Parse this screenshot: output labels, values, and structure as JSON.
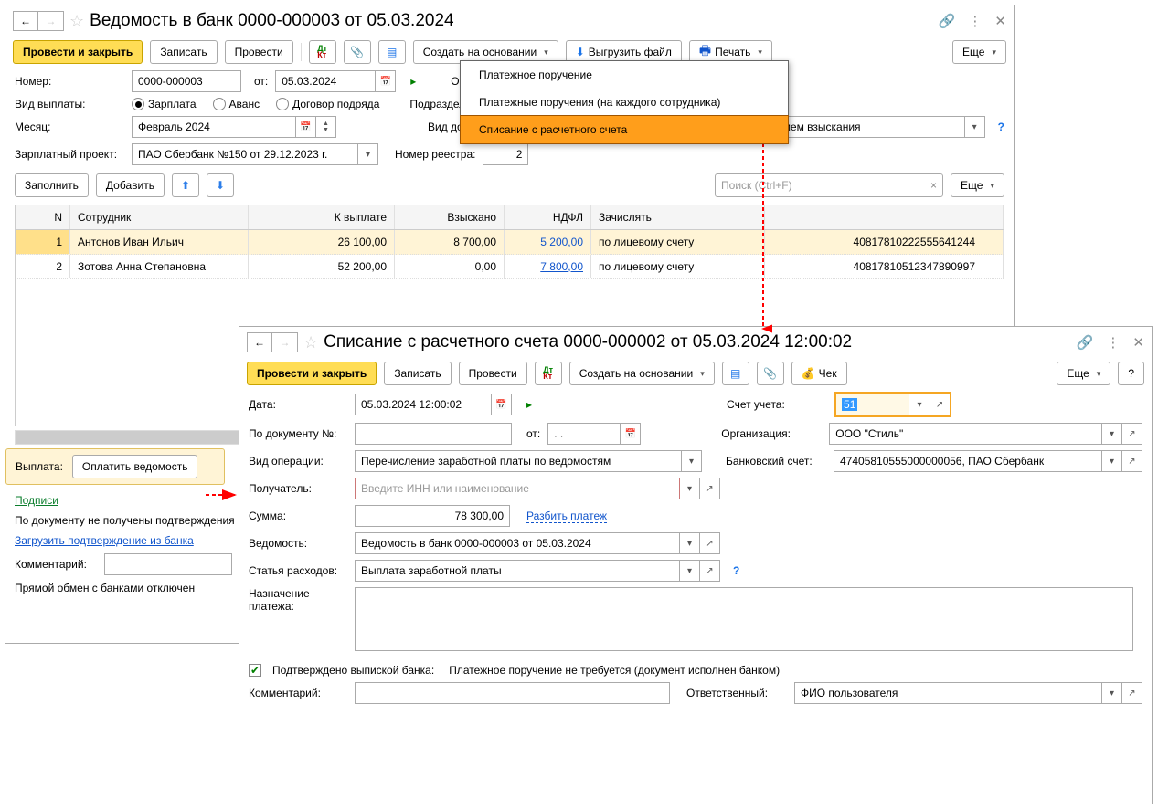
{
  "win1": {
    "title": "Ведомость в банк 0000-000003 от 05.03.2024",
    "toolbar": {
      "post_close": "Провести и закрыть",
      "save": "Записать",
      "post": "Провести",
      "create_based": "Создать на основании",
      "export_file": "Выгрузить файл",
      "print": "Печать",
      "more": "Еще"
    },
    "ctx_menu": {
      "item1": "Платежное поручение",
      "item2": "Платежные поручения (на каждого сотрудника)",
      "item3": "Списание с расчетного счета"
    },
    "labels": {
      "number": "Номер:",
      "date_from": "от:",
      "org": "Организация:",
      "pay_type": "Вид выплаты:",
      "subdiv": "Подразделение:",
      "month": "Месяц:",
      "income_type": "Вид дохода:",
      "salary_project": "Зарплатный проект:",
      "registry_num": "Номер реестра:",
      "fill": "Заполнить",
      "add": "Добавить",
      "search_ph": "Поиск (Ctrl+F)",
      "more2": "Еще",
      "payment": "Выплата:",
      "pay_btn": "Оплатить ведомость",
      "signatures": "Подписи",
      "no_confirm": "По документу не получены подтверждения",
      "load_confirm": "Загрузить подтверждение из банка",
      "comment": "Комментарий:",
      "exchange_off": "Прямой обмен с банками отключен"
    },
    "values": {
      "number": "0000-000003",
      "date": "05.03.2024",
      "month": "Февраль 2024",
      "income_type": "1 - Заработная плата и иные доходы с ограничением взыскания",
      "salary_project": "ПАО Сбербанк №150 от 29.12.2023 г.",
      "registry_num": "2"
    },
    "radios": {
      "salary": "Зарплата",
      "advance": "Аванс",
      "contract": "Договор подряда"
    },
    "table": {
      "headers": {
        "n": "N",
        "emp": "Сотрудник",
        "pay": "К выплате",
        "ded": "Взыскано",
        "tax": "НДФЛ",
        "acc": "Зачислять",
        "num": ""
      },
      "rows": [
        {
          "n": "1",
          "emp": "Антонов Иван Ильич",
          "pay": "26 100,00",
          "ded": "8 700,00",
          "tax": "5 200,00",
          "acc": "по лицевому счету",
          "num": "40817810222555641244"
        },
        {
          "n": "2",
          "emp": "Зотова Анна Степановна",
          "pay": "52 200,00",
          "ded": "0,00",
          "tax": "7 800,00",
          "acc": "по лицевому счету",
          "num": "40817810512347890997"
        }
      ]
    }
  },
  "win2": {
    "title": "Списание с расчетного счета 0000-000002 от 05.03.2024 12:00:02",
    "toolbar": {
      "post_close": "Провести и закрыть",
      "save": "Записать",
      "post": "Провести",
      "create_based": "Создать на основании",
      "check": "Чек",
      "more": "Еще",
      "help": "?"
    },
    "labels": {
      "date": "Дата:",
      "doc_no": "По документу №:",
      "from": "от:",
      "account": "Счет учета:",
      "org": "Организация:",
      "op_type": "Вид операции:",
      "bank_acc": "Банковский счет:",
      "recipient": "Получатель:",
      "recipient_ph": "Введите ИНН или наименование",
      "sum": "Сумма:",
      "split": "Разбить платеж",
      "vedom": "Ведомость:",
      "expense": "Статья расходов:",
      "purpose": "Назначение платежа:",
      "confirmed": "Подтверждено выпиской банка:",
      "confirm_text": "Платежное поручение не требуется (документ исполнен банком)",
      "comment": "Комментарий:",
      "responsible": "Ответственный:"
    },
    "values": {
      "date": "05.03.2024 12:00:02",
      "doc_no": "",
      "from": ".  .",
      "account": "51",
      "org": "ООО \"Стиль\"",
      "op_type": "Перечисление заработной платы по ведомостям",
      "bank_acc": "47405810555000000056, ПАО Сбербанк",
      "sum": "78 300,00",
      "vedom": "Ведомость в банк 0000-000003 от 05.03.2024",
      "expense": "Выплата заработной платы",
      "responsible": "ФИО пользователя"
    }
  }
}
